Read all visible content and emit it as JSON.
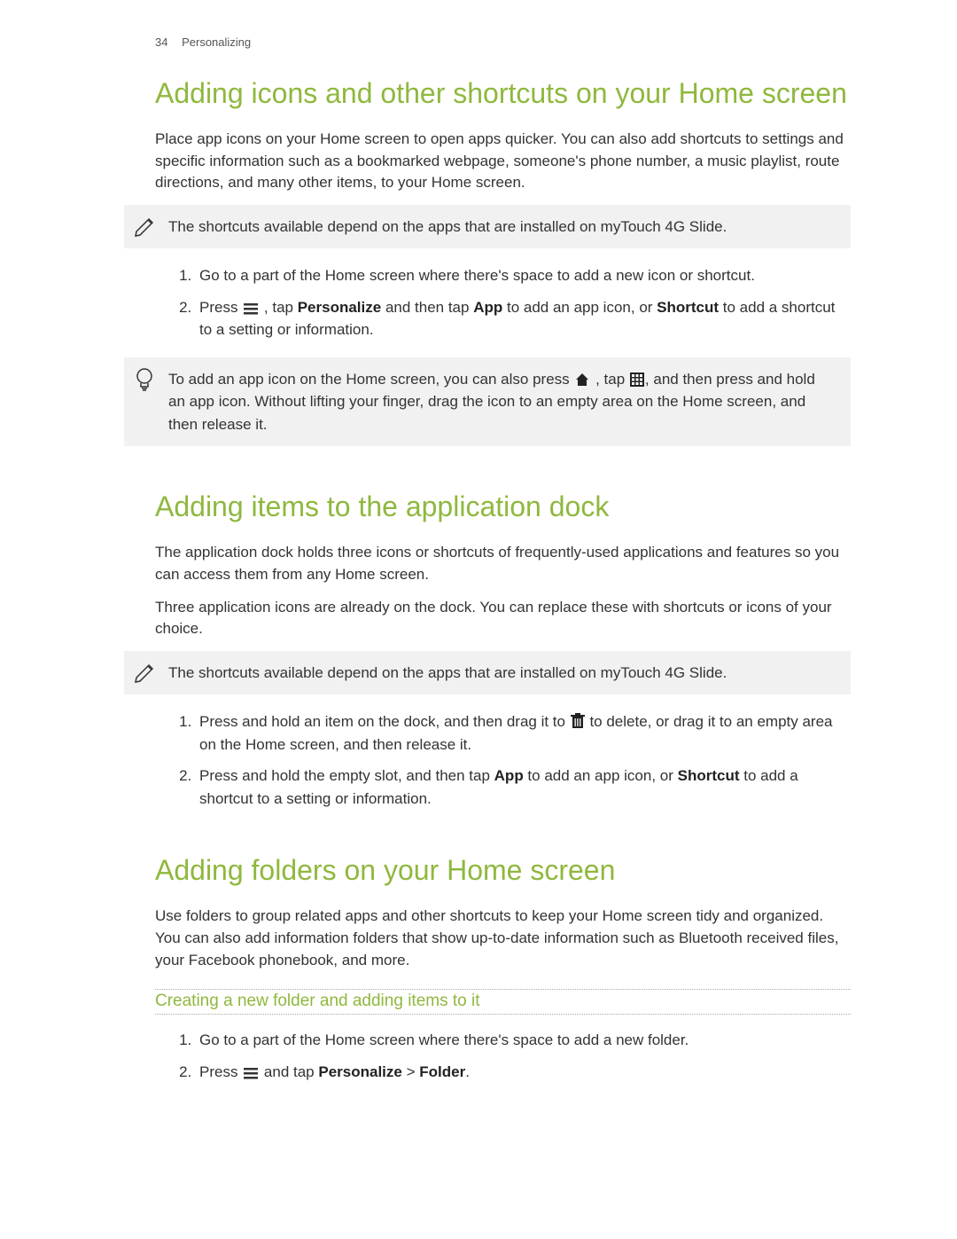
{
  "header": {
    "page_num": "34",
    "section": "Personalizing"
  },
  "s1": {
    "title": "Adding icons and other shortcuts on your Home screen",
    "intro": "Place app icons on your Home screen to open apps quicker. You can also add shortcuts to settings and specific information such as a bookmarked webpage, someone's phone number, a music playlist, route directions, and many other items, to your Home screen.",
    "note": "The shortcuts available depend on the apps that are installed on myTouch 4G Slide.",
    "step1": "Go to a part of the Home screen where there's space to add a new icon or shortcut.",
    "step2_a": "Press ",
    "step2_b": " , tap ",
    "step2_personalize": "Personalize",
    "step2_c": " and then tap ",
    "step2_app": "App",
    "step2_d": " to add an app icon, or ",
    "step2_shortcut": "Shortcut",
    "step2_e": " to add a shortcut to a setting or information.",
    "tip_a": "To add an app icon on the Home screen, you can also press ",
    "tip_b": " , tap ",
    "tip_c": ", and then press and hold an app icon. Without lifting your finger, drag the icon to an empty area on the Home screen, and then release it."
  },
  "s2": {
    "title": "Adding items to the application dock",
    "p1": "The application dock holds three icons or shortcuts of frequently-used applications and features so you can access them from any Home screen.",
    "p2": "Three application icons are already on the dock. You can replace these with shortcuts or icons of your choice.",
    "note": "The shortcuts available depend on the apps that are installed on myTouch 4G Slide.",
    "step1_a": "Press and hold an item on the dock, and then drag it to ",
    "step1_b": " to delete, or drag it to an empty area on the Home screen, and then release it.",
    "step2_a": "Press and hold the empty slot, and then tap ",
    "step2_app": "App",
    "step2_b": " to add an app icon, or ",
    "step2_shortcut": "Shortcut",
    "step2_c": " to add a shortcut to a setting or information."
  },
  "s3": {
    "title": "Adding folders on your Home screen",
    "p1": "Use folders to group related apps and other shortcuts to keep your Home screen tidy and organized. You can also add information folders that show up-to-date information such as Bluetooth received files, your Facebook phonebook, and more.",
    "sub": "Creating a new folder and adding items to it",
    "step1": "Go to a part of the Home screen where there's space to add a new folder.",
    "step2_a": "Press ",
    "step2_b": " and tap ",
    "step2_personalize": "Personalize",
    "step2_c": " > ",
    "step2_folder": "Folder",
    "step2_d": "."
  }
}
